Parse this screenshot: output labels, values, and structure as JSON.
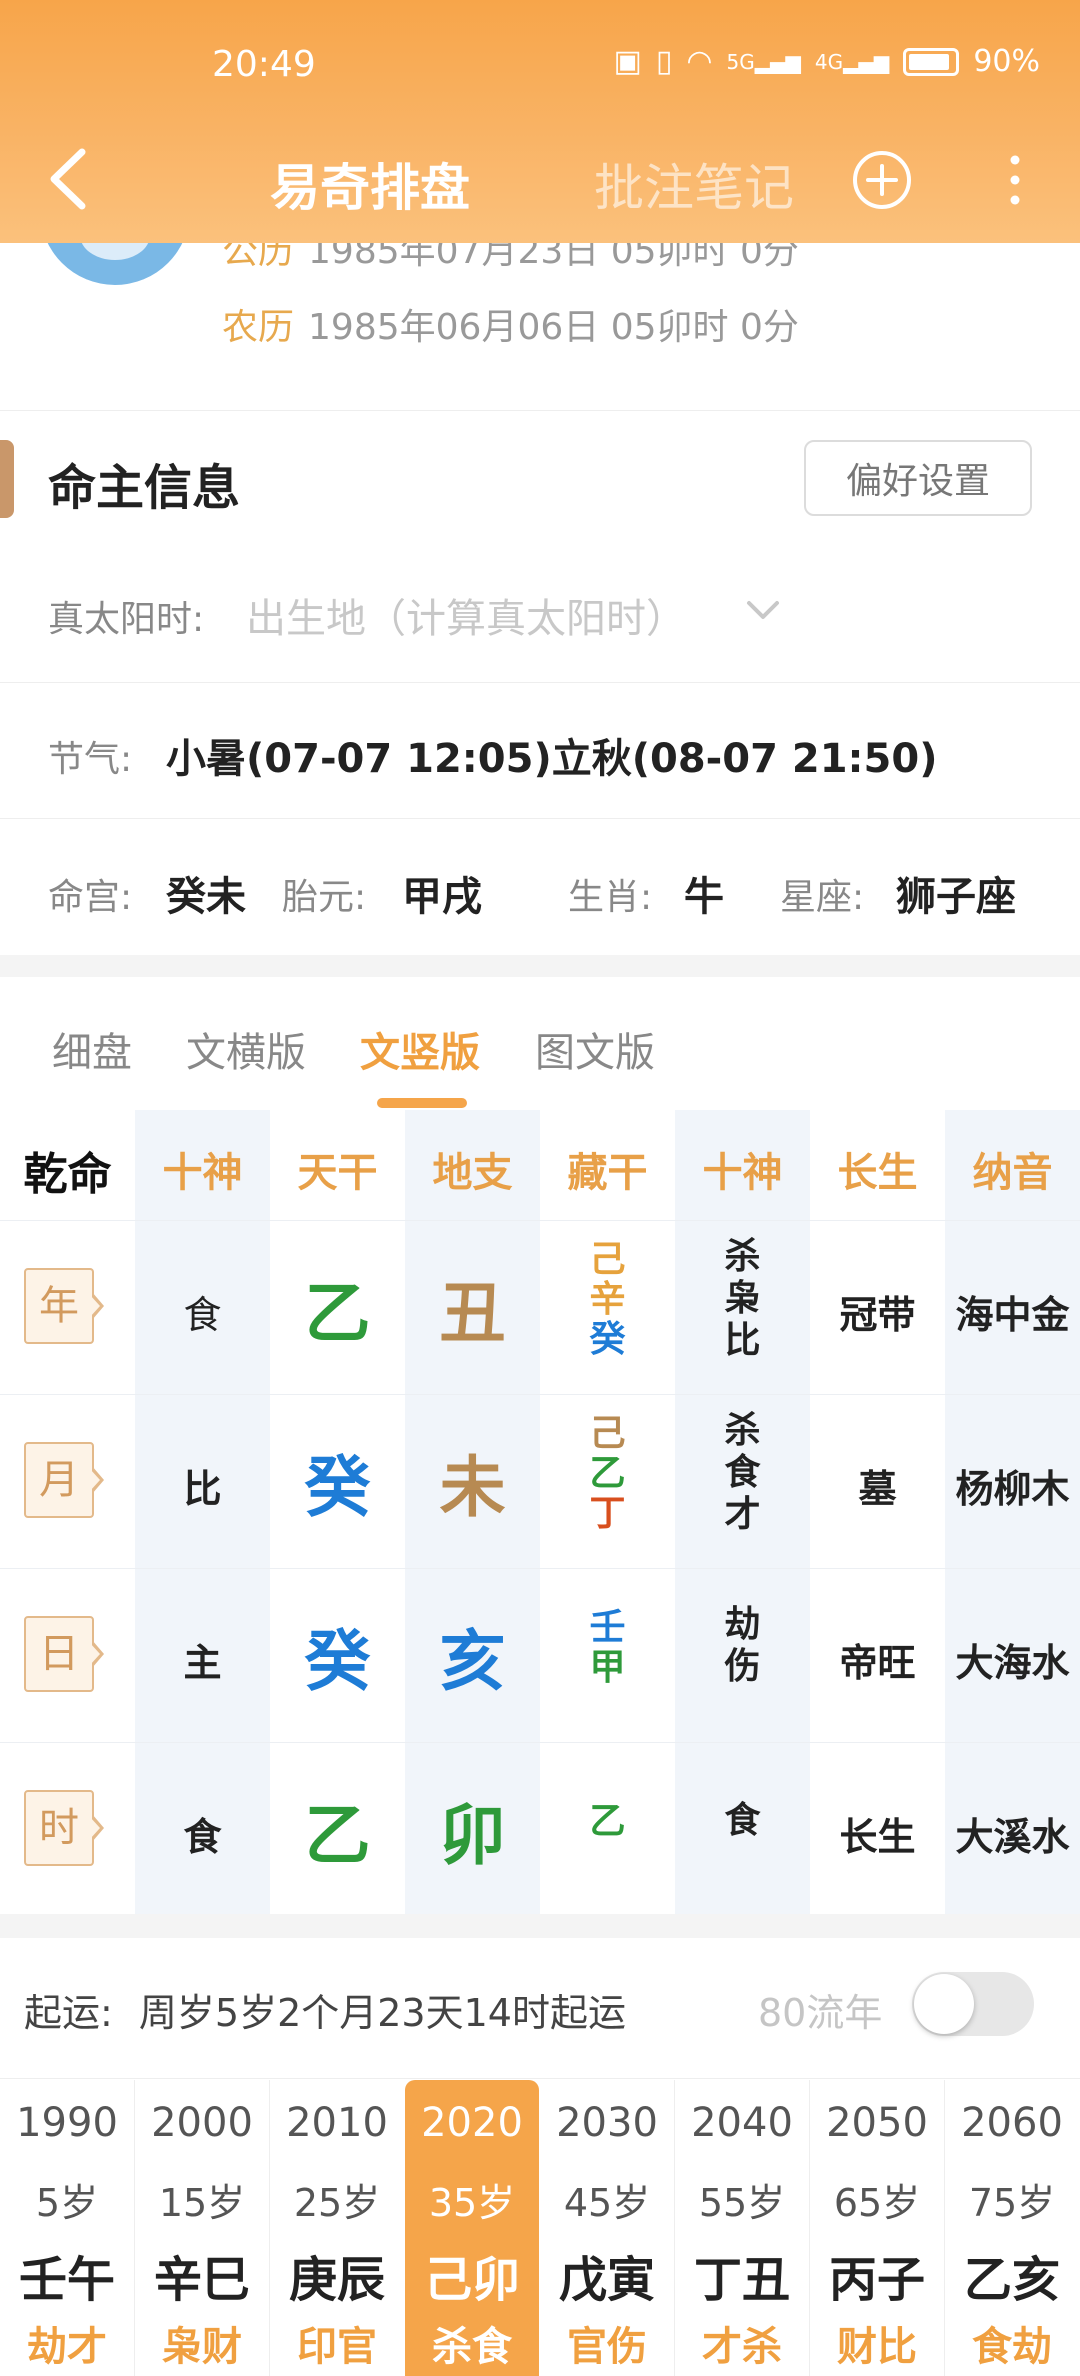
{
  "status": {
    "time": "20:49",
    "battery": "90%",
    "net1": "5G",
    "net2": "4G"
  },
  "nav": {
    "title": "易奇排盘",
    "notes": "批注笔记"
  },
  "profile": {
    "gongli_label": "公历",
    "gongli_value": "1985年07月23日 05卯时 0分",
    "nongli_label": "农历",
    "nongli_value": "1985年06月06日 05卯时 0分"
  },
  "section": {
    "title": "命主信息",
    "pref_button": "偏好设置"
  },
  "info": {
    "true_solar_label": "真太阳时:",
    "true_solar_hint": "出生地（计算真太阳时）",
    "jieqi_label": "节气:",
    "jieqi_value": "小暑(07-07 12:05)立秋(08-07 21:50)",
    "minggong_label": "命宫:",
    "minggong_value": "癸未",
    "taiyuan_label": "胎元:",
    "taiyuan_value": "甲戌",
    "shengxiao_label": "生肖:",
    "shengxiao_value": "牛",
    "xingzuo_label": "星座:",
    "xingzuo_value": "狮子座"
  },
  "tabs": [
    {
      "label": "细盘",
      "active": false
    },
    {
      "label": "文横版",
      "active": false
    },
    {
      "label": "文竖版",
      "active": true
    },
    {
      "label": "图文版",
      "active": false
    }
  ],
  "grid": {
    "corner": "乾命",
    "headers": [
      "十神",
      "天干",
      "地支",
      "藏干",
      "十神",
      "长生",
      "纳音"
    ],
    "rows": [
      {
        "pillar": "年",
        "shishen": "食",
        "gan": "乙",
        "zhi": "丑",
        "canggan": [
          "己",
          "辛",
          "癸"
        ],
        "shishen2": [
          "杀",
          "枭",
          "比"
        ],
        "changsheng": "冠带",
        "nayin": "海中金"
      },
      {
        "pillar": "月",
        "shishen": "比",
        "gan": "癸",
        "zhi": "未",
        "canggan": [
          "己",
          "乙",
          "丁"
        ],
        "shishen2": [
          "杀",
          "食",
          "才"
        ],
        "changsheng": "墓",
        "nayin": "杨柳木"
      },
      {
        "pillar": "日",
        "shishen": "主",
        "gan": "癸",
        "zhi": "亥",
        "canggan": [
          "壬",
          "甲"
        ],
        "shishen2": [
          "劫",
          "伤"
        ],
        "changsheng": "帝旺",
        "nayin": "大海水"
      },
      {
        "pillar": "时",
        "shishen": "食",
        "gan": "乙",
        "zhi": "卯",
        "canggan": [
          "乙"
        ],
        "shishen2": [
          "食"
        ],
        "changsheng": "长生",
        "nayin": "大溪水"
      }
    ]
  },
  "qiyun": {
    "label": "起运:",
    "value": "周岁5岁2个月23天14时起运",
    "liunian_label": "80流年",
    "liunian_on": false
  },
  "dayun": [
    {
      "year": "1990",
      "age": "5岁",
      "ganzhi": "壬午",
      "shishen": "劫才",
      "selected": false
    },
    {
      "year": "2000",
      "age": "15岁",
      "ganzhi": "辛巳",
      "shishen": "枭财",
      "selected": false
    },
    {
      "year": "2010",
      "age": "25岁",
      "ganzhi": "庚辰",
      "shishen": "印官",
      "selected": false
    },
    {
      "year": "2020",
      "age": "35岁",
      "ganzhi": "己卯",
      "shishen": "杀食",
      "selected": true
    },
    {
      "year": "2030",
      "age": "45岁",
      "ganzhi": "戊寅",
      "shishen": "官伤",
      "selected": false
    },
    {
      "year": "2040",
      "age": "55岁",
      "ganzhi": "丁丑",
      "shishen": "才杀",
      "selected": false
    },
    {
      "year": "2050",
      "age": "65岁",
      "ganzhi": "丙子",
      "shishen": "财比",
      "selected": false
    },
    {
      "year": "2060",
      "age": "75岁",
      "ganzhi": "乙亥",
      "shishen": "食劫",
      "selected": false
    }
  ],
  "colors": {
    "accent": "#f5a54a",
    "wood": "#2e9a3a",
    "water": "#1e7cd6",
    "earth": "#b78a52",
    "metal": "#e6a23c",
    "fire": "#d84f1e"
  }
}
